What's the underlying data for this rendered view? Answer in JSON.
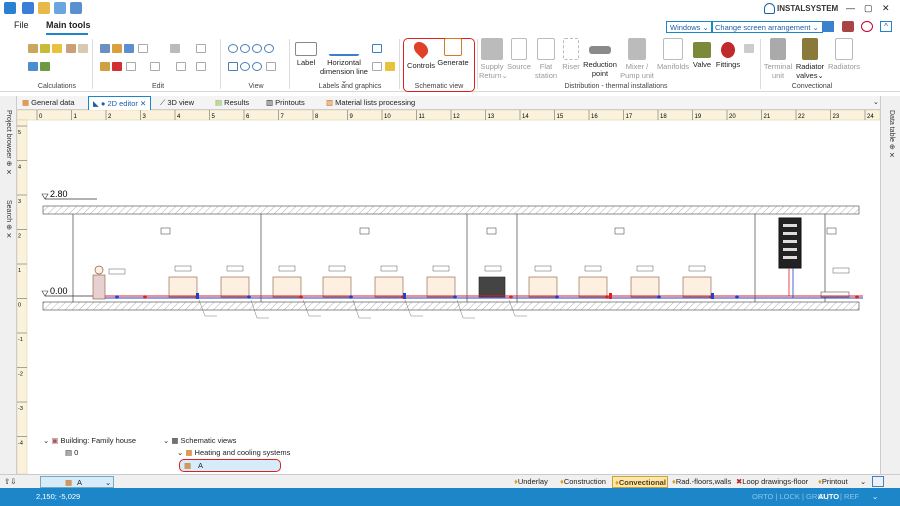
{
  "titlebar": {
    "brand": "INSTALSYSTEM",
    "min": "—",
    "max": "▢",
    "close": "✕"
  },
  "menubar": {
    "file": "File",
    "main_tools": "Main tools",
    "windows": "Windows ⌄",
    "arrangement": "Change screen arrangement ⌄"
  },
  "ribbon": {
    "groups": {
      "calculations": "Calculations",
      "edit": "Edit",
      "view": "View",
      "labels": "Labels and graphics",
      "schematic": "Schematic view",
      "distribution": "Distribution - thermal installations",
      "convectional": "Convectional"
    },
    "label": "Label",
    "hdim": "Horizontal dimension line ⌄",
    "controls": "Controls",
    "generate": "Generate",
    "supply": "Supply Return⌄",
    "source": "Source",
    "flat": "Flat station",
    "riser": "Riser",
    "reduction": "Reduction point",
    "mixer": "Mixer / Pump unit",
    "manifolds": "Manifolds",
    "valve": "Valve",
    "fittings": "Fittings",
    "terminal": "Terminal unit",
    "radvalves": "Radiator valves⌄",
    "radiators": "Radiators"
  },
  "doc_tabs": [
    "General data",
    "2D editor",
    "3D view",
    "Results",
    "Printouts",
    "Material lists processing"
  ],
  "side": {
    "left1": "Project browser",
    "left2": "Search",
    "right": "Data table"
  },
  "drawing": {
    "level_high": "2.80",
    "level_low": "0.00",
    "ruler_top": [
      "0",
      "1",
      "2",
      "3",
      "4",
      "5",
      "6",
      "7",
      "8",
      "9",
      "10",
      "11",
      "12",
      "13",
      "14",
      "15",
      "16",
      "17",
      "18",
      "19",
      "20",
      "21",
      "22",
      "23",
      "24"
    ],
    "ruler_left": [
      "5",
      "4",
      "3",
      "2",
      "1",
      "0",
      "-1",
      "-2",
      "-3",
      "-4"
    ]
  },
  "tree": {
    "building": "Building: Family house",
    "level": "0",
    "schematic": "Schematic views",
    "systems": "Heating and cooling systems",
    "item": "A"
  },
  "bottombar": {
    "sel": "A",
    "tabs": [
      "Underlay",
      "Construction",
      "Convectional",
      "Rad.-floors,walls",
      "Loop drawings-floor",
      "Printout"
    ]
  },
  "statusbar": {
    "coords": "2,150; -5,029",
    "flags": "ORTO | LOCK | GRID |",
    "auto": "AUTO",
    "ref": "| REF"
  },
  "colors": {
    "accent": "#1c86c9",
    "highlight": "#e02020"
  }
}
